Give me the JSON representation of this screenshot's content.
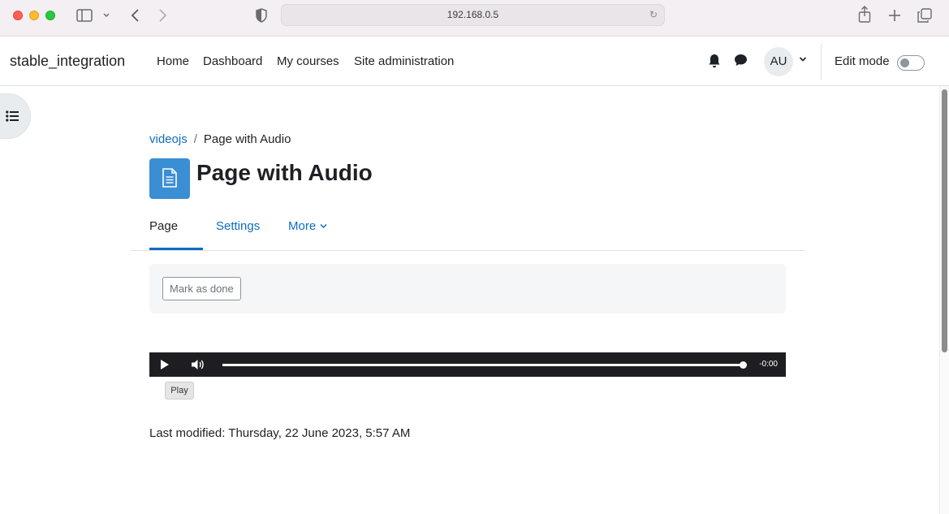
{
  "browser": {
    "url": "192.168.0.5"
  },
  "navbar": {
    "brand": "stable_integration",
    "links": [
      "Home",
      "Dashboard",
      "My courses",
      "Site administration"
    ],
    "avatar_initials": "AU",
    "edit_mode_label": "Edit mode",
    "edit_mode_on": false
  },
  "breadcrumb": {
    "parent": "videojs",
    "separator": "/",
    "current": "Page with Audio"
  },
  "page": {
    "title": "Page with Audio"
  },
  "tabs": {
    "page": "Page",
    "settings": "Settings",
    "more": "More"
  },
  "completion": {
    "mark_done_label": "Mark as done"
  },
  "player": {
    "time_remaining": "-0:00",
    "progress_fraction": 1.0,
    "tooltip": "Play"
  },
  "footer": {
    "last_modified": "Last modified: Thursday, 22 June 2023, 5:57 AM"
  },
  "colors": {
    "link": "#0f6cbf",
    "player_bg": "#1e1e22",
    "page_icon": "#3a8ed4"
  }
}
